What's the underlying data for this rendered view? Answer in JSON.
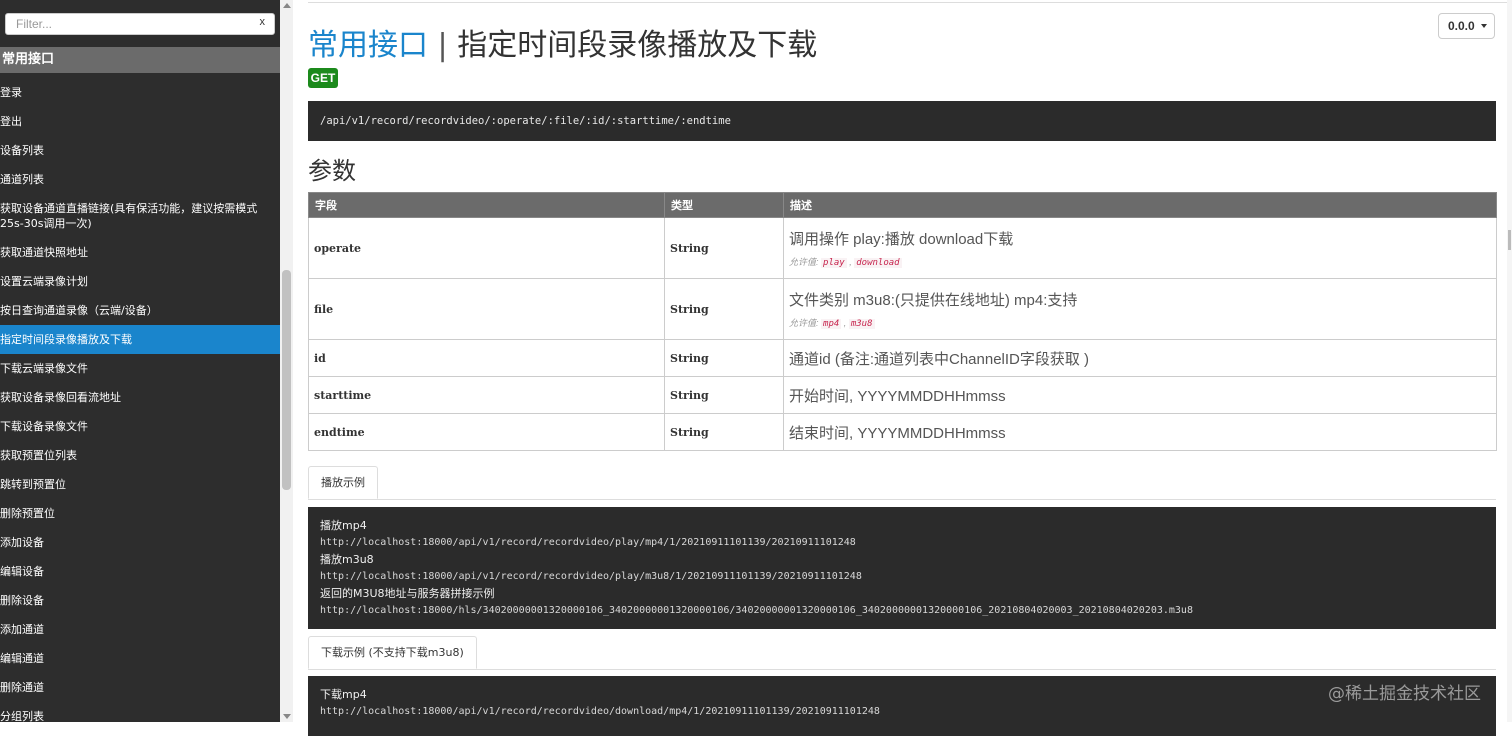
{
  "sidebar": {
    "filter_placeholder": "Filter...",
    "filter_clear": "x",
    "group_title": "常用接口",
    "items": [
      {
        "label": "登录"
      },
      {
        "label": "登出"
      },
      {
        "label": "设备列表"
      },
      {
        "label": "通道列表"
      },
      {
        "label": "获取设备通道直播链接(具有保活功能，建议按需模式25s-30s调用一次)"
      },
      {
        "label": "获取通道快照地址"
      },
      {
        "label": "设置云端录像计划"
      },
      {
        "label": "按日查询通道录像（云端/设备）"
      },
      {
        "label": "指定时间段录像播放及下载"
      },
      {
        "label": "下载云端录像文件"
      },
      {
        "label": "获取设备录像回看流地址"
      },
      {
        "label": "下载设备录像文件"
      },
      {
        "label": "获取预置位列表"
      },
      {
        "label": "跳转到预置位"
      },
      {
        "label": "删除预置位"
      },
      {
        "label": "添加设备"
      },
      {
        "label": "编辑设备"
      },
      {
        "label": "删除设备"
      },
      {
        "label": "添加通道"
      },
      {
        "label": "编辑通道"
      },
      {
        "label": "删除通道"
      },
      {
        "label": "分组列表"
      }
    ],
    "active_index": 8
  },
  "header": {
    "group": "常用接口",
    "separator": "|",
    "title": "指定时间段录像播放及下载",
    "version": "0.0.0",
    "method": "GET",
    "endpoint": "/api/v1/record/recordvideo/:operate/:file/:id/:starttime/:endtime"
  },
  "params": {
    "title": "参数",
    "columns": [
      "字段",
      "类型",
      "描述"
    ],
    "allowed_label": "允许值:",
    "rows": [
      {
        "field": "operate",
        "type": "String",
        "desc": "调用操作 play:播放 download下载",
        "allowed": [
          "play",
          "download"
        ]
      },
      {
        "field": "file",
        "type": "String",
        "desc": "文件类别 m3u8:(只提供在线地址) mp4:支持",
        "allowed": [
          "mp4",
          "m3u8"
        ]
      },
      {
        "field": "id",
        "type": "String",
        "desc": "通道id (备注:通道列表中ChannelID字段获取 )"
      },
      {
        "field": "starttime",
        "type": "String",
        "desc": "开始时间, YYYYMMDDHHmmss"
      },
      {
        "field": "endtime",
        "type": "String",
        "desc": "结束时间, YYYYMMDDHHmmss"
      }
    ]
  },
  "examples": {
    "play": {
      "tab": "播放示例",
      "lines": [
        {
          "kind": "label",
          "text": "播放mp4"
        },
        {
          "kind": "url",
          "text": "http://localhost:18000/api/v1/record/recordvideo/play/mp4/1/20210911101139/20210911101248"
        },
        {
          "kind": "label",
          "text": "播放m3u8"
        },
        {
          "kind": "url",
          "text": "http://localhost:18000/api/v1/record/recordvideo/play/m3u8/1/20210911101139/20210911101248"
        },
        {
          "kind": "label",
          "text": "返回的M3U8地址与服务器拼接示例"
        },
        {
          "kind": "url",
          "text": "http://localhost:18000/hls/34020000001320000106_34020000001320000106/34020000001320000106_34020000001320000106_20210804020003_20210804020203.m3u8"
        }
      ]
    },
    "download": {
      "tab": "下载示例 (不支持下载m3u8)",
      "lines": [
        {
          "kind": "label",
          "text": "下载mp4"
        },
        {
          "kind": "url",
          "text": "http://localhost:18000/api/v1/record/recordvideo/download/mp4/1/20210911101139/20210911101248"
        }
      ]
    }
  },
  "watermark": "@稀土掘金技术社区",
  "colors": {
    "sidebar_bg": "#2d2d2d",
    "sidebar_active": "#1a85cc",
    "group_header": "#6b6b6b",
    "accent": "#1a85cc",
    "get_badge": "#1c8a1c",
    "code_bg": "#2b2b2b",
    "allowed_value": "#c7254e"
  }
}
